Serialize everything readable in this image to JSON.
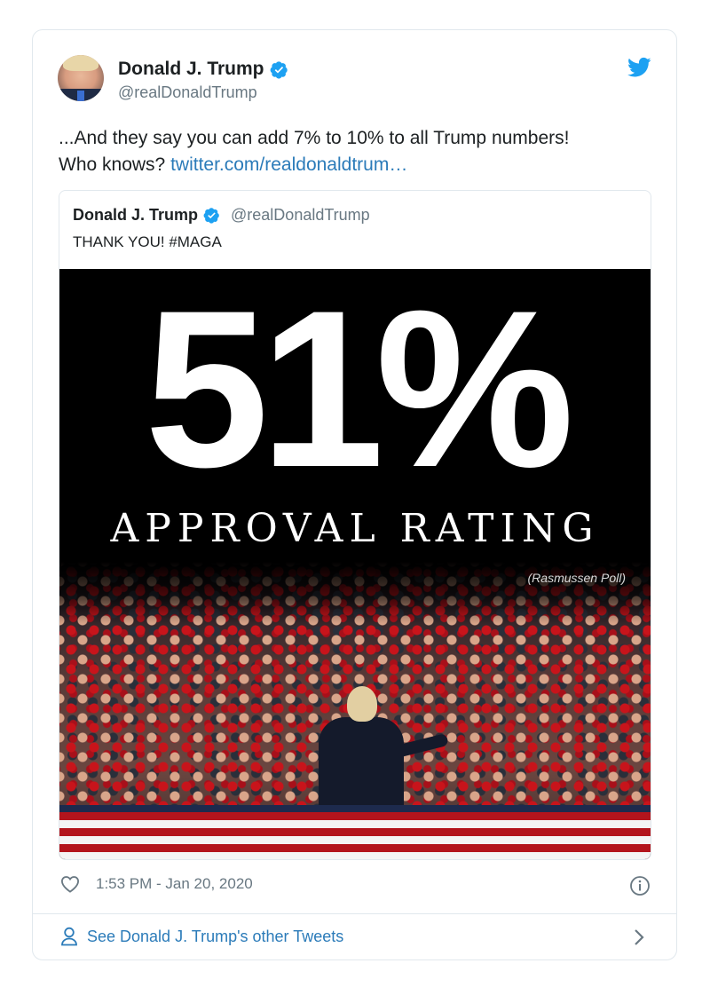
{
  "tweet": {
    "author_name": "Donald J. Trump",
    "author_handle": "@realDonaldTrump",
    "text_line1": "...And they say you can add 7% to 10% to all Trump numbers!",
    "text_line2_prefix": "Who knows?",
    "link_text": "twitter.com/realdonaldtrum…",
    "timestamp": "1:53 PM - Jan 20, 2020"
  },
  "quoted": {
    "author_name": "Donald J. Trump",
    "author_handle": "@realDonaldTrump",
    "text": "THANK YOU! #MAGA",
    "image": {
      "big_number": "51%",
      "caption": "APPROVAL RATING",
      "source_note": "(Rasmussen Poll)"
    }
  },
  "footer": {
    "other_tweets": "See Donald J. Trump's other Tweets"
  },
  "icons": {
    "verified": "verified-badge-icon",
    "bird": "twitter-bird-icon",
    "heart": "heart-icon",
    "info": "info-icon",
    "person": "person-icon",
    "chevron": "chevron-right-icon"
  },
  "colors": {
    "link": "#2b7bb9",
    "verified": "#1da1f2",
    "secondary_text": "#697882",
    "border": "#e1e8ed"
  }
}
